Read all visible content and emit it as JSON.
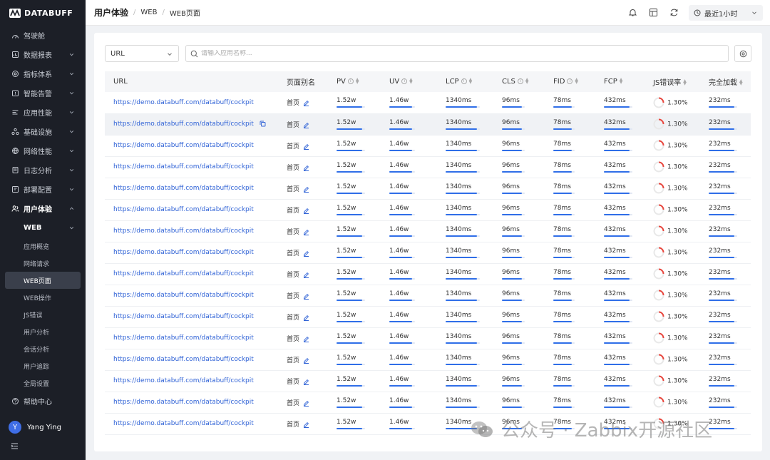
{
  "brand": {
    "name": "DATABUFF"
  },
  "sidebar": {
    "items": [
      {
        "label": "驾驶舱",
        "icon": "dashboard-icon"
      },
      {
        "label": "数据报表",
        "icon": "report-icon",
        "expandable": true
      },
      {
        "label": "指标体系",
        "icon": "metrics-icon",
        "expandable": true
      },
      {
        "label": "智能告警",
        "icon": "alert-icon",
        "expandable": true
      },
      {
        "label": "应用性能",
        "icon": "apm-icon",
        "expandable": true
      },
      {
        "label": "基础设施",
        "icon": "infra-icon",
        "expandable": true
      },
      {
        "label": "网络性能",
        "icon": "network-icon",
        "expandable": true
      },
      {
        "label": "日志分析",
        "icon": "log-icon",
        "expandable": true
      },
      {
        "label": "部署配置",
        "icon": "deploy-icon",
        "expandable": true
      },
      {
        "label": "用户体验",
        "icon": "user-experience-icon",
        "expandable": true,
        "active": true
      }
    ],
    "web_group": {
      "label": "WEB"
    },
    "sub_items": [
      "应用概览",
      "网络请求",
      "WEB页面",
      "WEB操作",
      "JS错误",
      "用户分析",
      "会话分析",
      "用户追踪",
      "全局设置"
    ],
    "selected_sub": "WEB页面",
    "help": {
      "label": "帮助中心"
    },
    "user": {
      "initial": "Y",
      "name": "Yang Ying"
    }
  },
  "breadcrumb": [
    "用户体验",
    "WEB",
    "WEB页面"
  ],
  "time_range": {
    "value": "最近1小时"
  },
  "filter": {
    "value": "URL"
  },
  "search": {
    "placeholder": "请输入应用名称..."
  },
  "table": {
    "columns": [
      {
        "label": "URL"
      },
      {
        "label": "页面别名"
      },
      {
        "label": "PV",
        "info": true,
        "sortable": true
      },
      {
        "label": "UV",
        "info": true,
        "sortable": true
      },
      {
        "label": "LCP",
        "info": true,
        "sortable": true
      },
      {
        "label": "CLS",
        "info": true,
        "sortable": true
      },
      {
        "label": "FID",
        "info": true,
        "sortable": true
      },
      {
        "label": "FCP",
        "sortable": true
      },
      {
        "label": "JS错误率",
        "sortable": true
      },
      {
        "label": "完全加载",
        "sortable": true
      }
    ],
    "rows": [
      {
        "url": "https://demo.databuff.com/databuff/cockpit",
        "alias": "首页",
        "pv": "1.52w",
        "uv": "1.46w",
        "lcp": "1340ms",
        "cls": "96ms",
        "fid": "78ms",
        "fcp": "432ms",
        "js_error": "1.30%",
        "load": "232ms"
      },
      {
        "url": "https://demo.databuff.com/databuff/cockpit",
        "alias": "首页",
        "pv": "1.52w",
        "uv": "1.46w",
        "lcp": "1340ms",
        "cls": "96ms",
        "fid": "78ms",
        "fcp": "432ms",
        "js_error": "1.30%",
        "load": "232ms",
        "hovered": true
      },
      {
        "url": "https://demo.databuff.com/databuff/cockpit",
        "alias": "首页",
        "pv": "1.52w",
        "uv": "1.46w",
        "lcp": "1340ms",
        "cls": "96ms",
        "fid": "78ms",
        "fcp": "432ms",
        "js_error": "1.30%",
        "load": "232ms"
      },
      {
        "url": "https://demo.databuff.com/databuff/cockpit",
        "alias": "首页",
        "pv": "1.52w",
        "uv": "1.46w",
        "lcp": "1340ms",
        "cls": "96ms",
        "fid": "78ms",
        "fcp": "432ms",
        "js_error": "1.30%",
        "load": "232ms"
      },
      {
        "url": "https://demo.databuff.com/databuff/cockpit",
        "alias": "首页",
        "pv": "1.52w",
        "uv": "1.46w",
        "lcp": "1340ms",
        "cls": "96ms",
        "fid": "78ms",
        "fcp": "432ms",
        "js_error": "1.30%",
        "load": "232ms"
      },
      {
        "url": "https://demo.databuff.com/databuff/cockpit",
        "alias": "首页",
        "pv": "1.52w",
        "uv": "1.46w",
        "lcp": "1340ms",
        "cls": "96ms",
        "fid": "78ms",
        "fcp": "432ms",
        "js_error": "1.30%",
        "load": "232ms"
      },
      {
        "url": "https://demo.databuff.com/databuff/cockpit",
        "alias": "首页",
        "pv": "1.52w",
        "uv": "1.46w",
        "lcp": "1340ms",
        "cls": "96ms",
        "fid": "78ms",
        "fcp": "432ms",
        "js_error": "1.30%",
        "load": "232ms"
      },
      {
        "url": "https://demo.databuff.com/databuff/cockpit",
        "alias": "首页",
        "pv": "1.52w",
        "uv": "1.46w",
        "lcp": "1340ms",
        "cls": "96ms",
        "fid": "78ms",
        "fcp": "432ms",
        "js_error": "1.30%",
        "load": "232ms"
      },
      {
        "url": "https://demo.databuff.com/databuff/cockpit",
        "alias": "首页",
        "pv": "1.52w",
        "uv": "1.46w",
        "lcp": "1340ms",
        "cls": "96ms",
        "fid": "78ms",
        "fcp": "432ms",
        "js_error": "1.30%",
        "load": "232ms"
      },
      {
        "url": "https://demo.databuff.com/databuff/cockpit",
        "alias": "首页",
        "pv": "1.52w",
        "uv": "1.46w",
        "lcp": "1340ms",
        "cls": "96ms",
        "fid": "78ms",
        "fcp": "432ms",
        "js_error": "1.30%",
        "load": "232ms"
      },
      {
        "url": "https://demo.databuff.com/databuff/cockpit",
        "alias": "首页",
        "pv": "1.52w",
        "uv": "1.46w",
        "lcp": "1340ms",
        "cls": "96ms",
        "fid": "78ms",
        "fcp": "432ms",
        "js_error": "1.30%",
        "load": "232ms"
      },
      {
        "url": "https://demo.databuff.com/databuff/cockpit",
        "alias": "首页",
        "pv": "1.52w",
        "uv": "1.46w",
        "lcp": "1340ms",
        "cls": "96ms",
        "fid": "78ms",
        "fcp": "432ms",
        "js_error": "1.30%",
        "load": "232ms"
      },
      {
        "url": "https://demo.databuff.com/databuff/cockpit",
        "alias": "首页",
        "pv": "1.52w",
        "uv": "1.46w",
        "lcp": "1340ms",
        "cls": "96ms",
        "fid": "78ms",
        "fcp": "432ms",
        "js_error": "1.30%",
        "load": "232ms"
      },
      {
        "url": "https://demo.databuff.com/databuff/cockpit",
        "alias": "首页",
        "pv": "1.52w",
        "uv": "1.46w",
        "lcp": "1340ms",
        "cls": "96ms",
        "fid": "78ms",
        "fcp": "432ms",
        "js_error": "1.30%",
        "load": "232ms"
      },
      {
        "url": "https://demo.databuff.com/databuff/cockpit",
        "alias": "首页",
        "pv": "1.52w",
        "uv": "1.46w",
        "lcp": "1340ms",
        "cls": "96ms",
        "fid": "78ms",
        "fcp": "432ms",
        "js_error": "1.30%",
        "load": "232ms"
      },
      {
        "url": "https://demo.databuff.com/databuff/cockpit",
        "alias": "首页",
        "pv": "1.52w",
        "uv": "1.46w",
        "lcp": "1340ms",
        "cls": "96ms",
        "fid": "78ms",
        "fcp": "432ms",
        "js_error": "1.30%",
        "load": "232ms"
      }
    ]
  },
  "watermark": {
    "text": "公众号 · Zabbix开源社区"
  },
  "colors": {
    "accent": "#2f6ee8",
    "link": "#2f62d6",
    "sidebar_bg": "#1c1f27",
    "error_ring": "#e8453c"
  }
}
